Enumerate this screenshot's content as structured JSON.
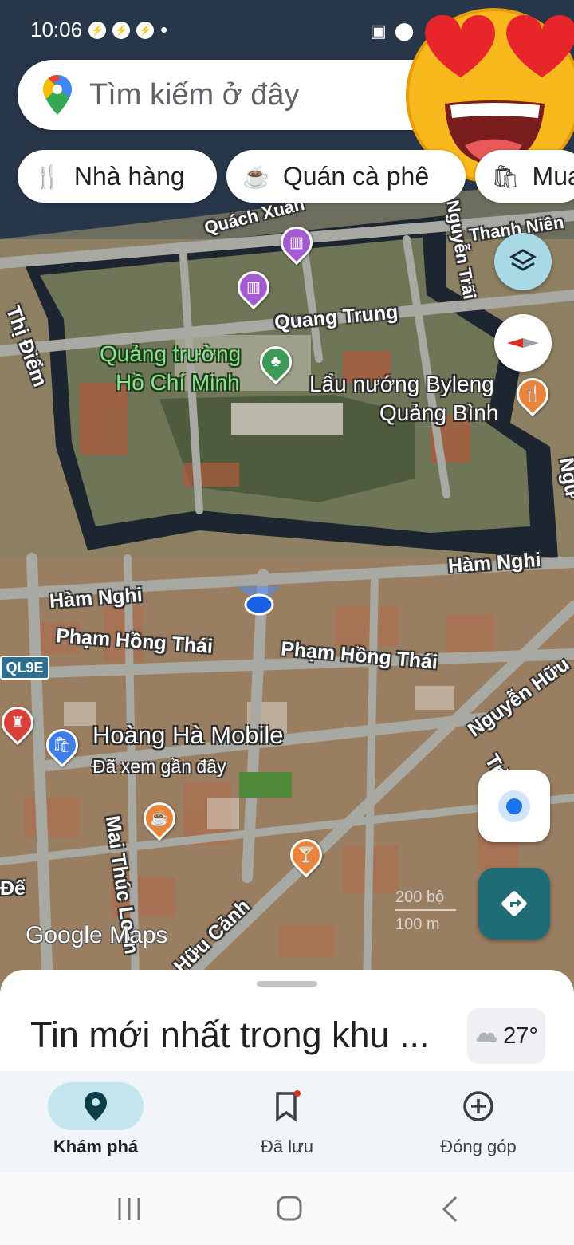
{
  "status_bar": {
    "time": "10:06",
    "dot": "•"
  },
  "search": {
    "placeholder": "Tìm kiếm ở đây"
  },
  "chips": [
    {
      "label": "Nhà hàng",
      "icon": "restaurant-icon"
    },
    {
      "label": "Quán cà phê",
      "icon": "coffee-icon"
    },
    {
      "label": "Mua",
      "icon": "shopping-icon"
    }
  ],
  "map": {
    "streets": {
      "quach_xuan": "Quách Xuân",
      "nguyen_trai": "Nguyễn Trãi",
      "thanh_nien": "Thanh Niên",
      "quang_trung": "Quang Trung",
      "thi_diem": "Thị Điểm",
      "ham_nghi_right": "Hàm Nghi",
      "ham_nghi_left": "Hàm Nghi",
      "pham_hong_thai_left": "Phạm Hồng Thái",
      "pham_hong_thai_right": "Phạm Hồng Thái",
      "nguyen_huu": "Nguyễn Hữu",
      "mai_thuc_loan": "Mai Thúc Loan",
      "huu_canh": "Hữu Cảnh",
      "de": "Đế",
      "ngu": "Ngư",
      "tran": "Trầ"
    },
    "pois": {
      "square_line1": "Quảng trường",
      "square_line2": "Hồ Chí Minh",
      "restaurant_line1": "Lẩu nướng Byleng",
      "restaurant_line2": "Quảng Bình",
      "shop_name": "Hoàng Hà Mobile",
      "shop_sub": "Đã xem gần đây"
    },
    "route_shield": "QL9E",
    "scale": {
      "feet": "200 bộ",
      "meters": "100 m"
    },
    "watermark": "Google Maps"
  },
  "sheet": {
    "title": "Tin mới nhất trong khu ...",
    "temperature": "27°"
  },
  "nav": {
    "explore": "Khám phá",
    "saved": "Đã lưu",
    "contribute": "Đóng góp"
  },
  "colors": {
    "accent": "#1a73e8",
    "nav_active_bg": "#c4e7ef",
    "directions_btn": "#1f6c77",
    "layers_btn": "#a9d9e4"
  }
}
